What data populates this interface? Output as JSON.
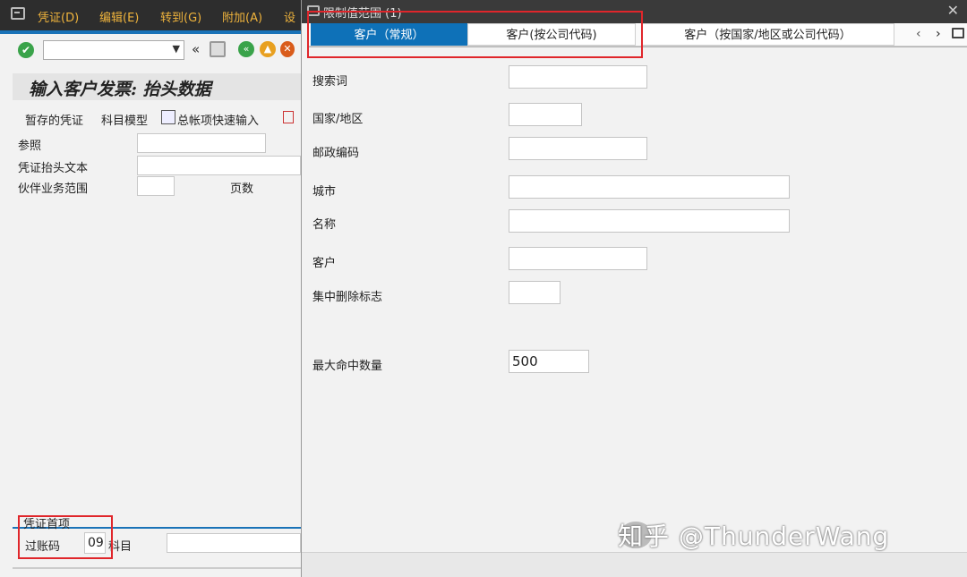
{
  "menubar": {
    "items": [
      "凭证(D)",
      "编辑(E)",
      "转到(G)",
      "附加(A)",
      "设"
    ]
  },
  "toolbar": {
    "command_value": "",
    "back_glyph": "«"
  },
  "page": {
    "title": "输入客户发票: 抬头数据",
    "app_toolbar": [
      "暂存的凭证",
      "科目模型",
      "总帐项快速输入"
    ]
  },
  "header_form": {
    "reference_label": "参照",
    "reference_value": "",
    "header_text_label": "凭证抬头文本",
    "header_text_value": "",
    "partner_area_label": "伙伴业务范围",
    "partner_area_value": "",
    "page_count_label": "页数"
  },
  "first_item": {
    "section_label": "凭证首项",
    "posting_key_label": "过账码",
    "posting_key_value": "09",
    "account_label": "科目",
    "account_value": ""
  },
  "dialog": {
    "title": "限制值范围 (1)",
    "close_glyph": "✕",
    "tabs": [
      "客户（常规）",
      "客户(按公司代码)",
      "客户（按国家/地区或公司代码）"
    ],
    "active_tab": 0,
    "fields": {
      "search_term_label": "搜索词",
      "search_term_value": "",
      "country_label": "国家/地区",
      "country_value": "",
      "postal_code_label": "邮政编码",
      "postal_code_value": "",
      "city_label": "城市",
      "city_value": "",
      "name_label": "名称",
      "name_value": "",
      "customer_label": "客户",
      "customer_value": "",
      "central_deletion_label": "集中删除标志",
      "central_deletion_value": "",
      "max_hits_label": "最大命中数量",
      "max_hits_value": "500"
    }
  },
  "watermark": {
    "text": "知乎 @ThunderWang"
  },
  "colors": {
    "menubar_bg": "#2d2d2d",
    "menu_text": "#f0b43c",
    "active_tab": "#0e71b8",
    "highlight_box": "#e0262b"
  }
}
